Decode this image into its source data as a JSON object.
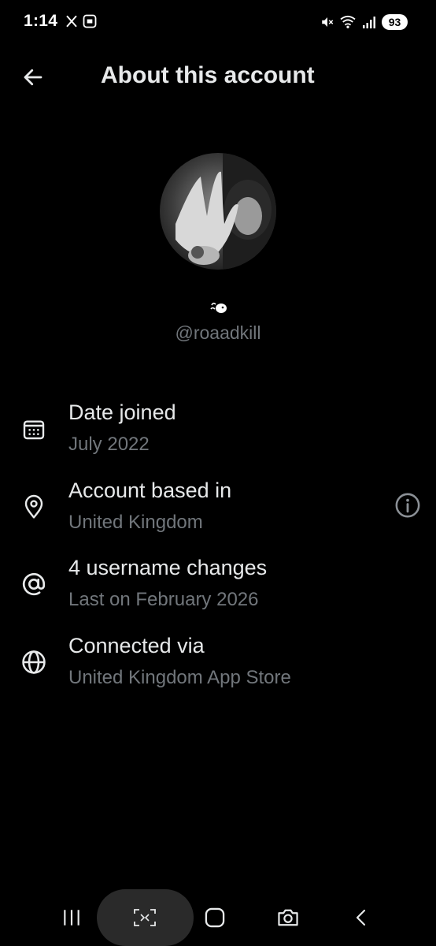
{
  "status_bar": {
    "time": "1:14",
    "battery": "93",
    "left_icons": [
      "x-app-icon",
      "screen-capture-icon"
    ],
    "right_icons": [
      "mute-icon",
      "wifi-icon",
      "signal-icon"
    ]
  },
  "header": {
    "title": "About this account",
    "back_icon": "arrow-left-icon"
  },
  "profile": {
    "handle": "@roaadkill",
    "display_name_icon": "emoji-icon"
  },
  "rows": [
    {
      "icon": "calendar-icon",
      "title": "Date joined",
      "subtitle": "July 2022"
    },
    {
      "icon": "location-pin-icon",
      "title": "Account based in",
      "subtitle": "United Kingdom",
      "trailing_icon": "info-icon"
    },
    {
      "icon": "at-sign-icon",
      "title": "4 username changes",
      "subtitle": "Last on February 2026"
    },
    {
      "icon": "globe-icon",
      "title": "Connected via",
      "subtitle": "United Kingdom App Store"
    }
  ],
  "nav_bar": {
    "items": [
      "recent-apps-icon",
      "screen-capture-icon",
      "home-icon",
      "camera-icon",
      "back-chevron-icon"
    ]
  },
  "colors": {
    "background": "#000000",
    "primary_text": "#e7e9ea",
    "secondary_text": "#71767b"
  }
}
